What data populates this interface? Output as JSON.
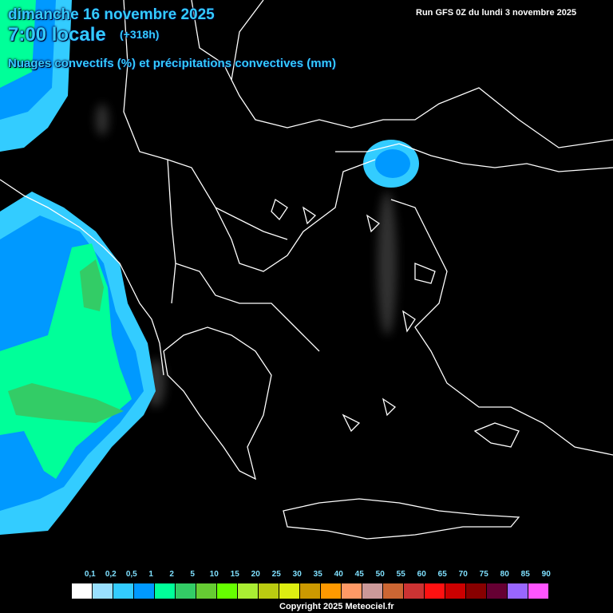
{
  "header": {
    "date": "dimanche 16 novembre 2025",
    "time": "7:00 locale",
    "lead": "(+318h)",
    "parameter": "Nuages convectifs (%) et précipitations convectives (mm)",
    "run": "Run GFS 0Z du lundi 3 novembre 2025"
  },
  "legend": {
    "labels": [
      "0,1",
      "0,2",
      "0,5",
      "1",
      "2",
      "5",
      "10",
      "15",
      "20",
      "25",
      "30",
      "35",
      "40",
      "45",
      "50",
      "55",
      "60",
      "65",
      "70",
      "75",
      "80",
      "85",
      "90"
    ],
    "colors": [
      "#ffffff",
      "#99e0ff",
      "#33ccff",
      "#0099ff",
      "#00ff99",
      "#33cc66",
      "#66cc33",
      "#66ff00",
      "#aaee33",
      "#bbcc11",
      "#ddee11",
      "#cc9900",
      "#ff9900",
      "#ff9966",
      "#cc9999",
      "#cc6633",
      "#cc3333",
      "#ff1111",
      "#cc0000",
      "#880000",
      "#660033",
      "#9966ff",
      "#ff55ff"
    ]
  },
  "footer": {
    "copyright": "Copyright 2025 Meteociel.fr"
  }
}
